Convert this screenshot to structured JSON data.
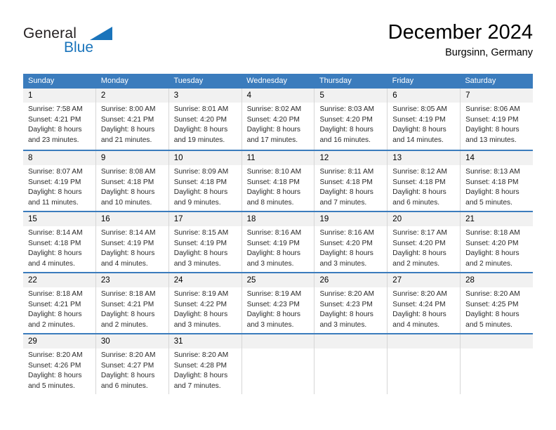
{
  "brand": {
    "name_part1": "General",
    "name_part2": "Blue",
    "accent_color": "#1a74bb"
  },
  "header": {
    "title": "December 2024",
    "subtitle": "Burgsinn, Germany"
  },
  "theme": {
    "header_blue": "#3b7cbd",
    "daynumber_bg": "#f1f1f1",
    "cell_border": "#d6d6d6"
  },
  "weekdays": [
    "Sunday",
    "Monday",
    "Tuesday",
    "Wednesday",
    "Thursday",
    "Friday",
    "Saturday"
  ],
  "weeks": [
    [
      {
        "date": "1",
        "sunrise": "Sunrise: 7:58 AM",
        "sunset": "Sunset: 4:21 PM",
        "daylight_line1": "Daylight: 8 hours",
        "daylight_line2": "and 23 minutes."
      },
      {
        "date": "2",
        "sunrise": "Sunrise: 8:00 AM",
        "sunset": "Sunset: 4:21 PM",
        "daylight_line1": "Daylight: 8 hours",
        "daylight_line2": "and 21 minutes."
      },
      {
        "date": "3",
        "sunrise": "Sunrise: 8:01 AM",
        "sunset": "Sunset: 4:20 PM",
        "daylight_line1": "Daylight: 8 hours",
        "daylight_line2": "and 19 minutes."
      },
      {
        "date": "4",
        "sunrise": "Sunrise: 8:02 AM",
        "sunset": "Sunset: 4:20 PM",
        "daylight_line1": "Daylight: 8 hours",
        "daylight_line2": "and 17 minutes."
      },
      {
        "date": "5",
        "sunrise": "Sunrise: 8:03 AM",
        "sunset": "Sunset: 4:20 PM",
        "daylight_line1": "Daylight: 8 hours",
        "daylight_line2": "and 16 minutes."
      },
      {
        "date": "6",
        "sunrise": "Sunrise: 8:05 AM",
        "sunset": "Sunset: 4:19 PM",
        "daylight_line1": "Daylight: 8 hours",
        "daylight_line2": "and 14 minutes."
      },
      {
        "date": "7",
        "sunrise": "Sunrise: 8:06 AM",
        "sunset": "Sunset: 4:19 PM",
        "daylight_line1": "Daylight: 8 hours",
        "daylight_line2": "and 13 minutes."
      }
    ],
    [
      {
        "date": "8",
        "sunrise": "Sunrise: 8:07 AM",
        "sunset": "Sunset: 4:19 PM",
        "daylight_line1": "Daylight: 8 hours",
        "daylight_line2": "and 11 minutes."
      },
      {
        "date": "9",
        "sunrise": "Sunrise: 8:08 AM",
        "sunset": "Sunset: 4:18 PM",
        "daylight_line1": "Daylight: 8 hours",
        "daylight_line2": "and 10 minutes."
      },
      {
        "date": "10",
        "sunrise": "Sunrise: 8:09 AM",
        "sunset": "Sunset: 4:18 PM",
        "daylight_line1": "Daylight: 8 hours",
        "daylight_line2": "and 9 minutes."
      },
      {
        "date": "11",
        "sunrise": "Sunrise: 8:10 AM",
        "sunset": "Sunset: 4:18 PM",
        "daylight_line1": "Daylight: 8 hours",
        "daylight_line2": "and 8 minutes."
      },
      {
        "date": "12",
        "sunrise": "Sunrise: 8:11 AM",
        "sunset": "Sunset: 4:18 PM",
        "daylight_line1": "Daylight: 8 hours",
        "daylight_line2": "and 7 minutes."
      },
      {
        "date": "13",
        "sunrise": "Sunrise: 8:12 AM",
        "sunset": "Sunset: 4:18 PM",
        "daylight_line1": "Daylight: 8 hours",
        "daylight_line2": "and 6 minutes."
      },
      {
        "date": "14",
        "sunrise": "Sunrise: 8:13 AM",
        "sunset": "Sunset: 4:18 PM",
        "daylight_line1": "Daylight: 8 hours",
        "daylight_line2": "and 5 minutes."
      }
    ],
    [
      {
        "date": "15",
        "sunrise": "Sunrise: 8:14 AM",
        "sunset": "Sunset: 4:18 PM",
        "daylight_line1": "Daylight: 8 hours",
        "daylight_line2": "and 4 minutes."
      },
      {
        "date": "16",
        "sunrise": "Sunrise: 8:14 AM",
        "sunset": "Sunset: 4:19 PM",
        "daylight_line1": "Daylight: 8 hours",
        "daylight_line2": "and 4 minutes."
      },
      {
        "date": "17",
        "sunrise": "Sunrise: 8:15 AM",
        "sunset": "Sunset: 4:19 PM",
        "daylight_line1": "Daylight: 8 hours",
        "daylight_line2": "and 3 minutes."
      },
      {
        "date": "18",
        "sunrise": "Sunrise: 8:16 AM",
        "sunset": "Sunset: 4:19 PM",
        "daylight_line1": "Daylight: 8 hours",
        "daylight_line2": "and 3 minutes."
      },
      {
        "date": "19",
        "sunrise": "Sunrise: 8:16 AM",
        "sunset": "Sunset: 4:20 PM",
        "daylight_line1": "Daylight: 8 hours",
        "daylight_line2": "and 3 minutes."
      },
      {
        "date": "20",
        "sunrise": "Sunrise: 8:17 AM",
        "sunset": "Sunset: 4:20 PM",
        "daylight_line1": "Daylight: 8 hours",
        "daylight_line2": "and 2 minutes."
      },
      {
        "date": "21",
        "sunrise": "Sunrise: 8:18 AM",
        "sunset": "Sunset: 4:20 PM",
        "daylight_line1": "Daylight: 8 hours",
        "daylight_line2": "and 2 minutes."
      }
    ],
    [
      {
        "date": "22",
        "sunrise": "Sunrise: 8:18 AM",
        "sunset": "Sunset: 4:21 PM",
        "daylight_line1": "Daylight: 8 hours",
        "daylight_line2": "and 2 minutes."
      },
      {
        "date": "23",
        "sunrise": "Sunrise: 8:18 AM",
        "sunset": "Sunset: 4:21 PM",
        "daylight_line1": "Daylight: 8 hours",
        "daylight_line2": "and 2 minutes."
      },
      {
        "date": "24",
        "sunrise": "Sunrise: 8:19 AM",
        "sunset": "Sunset: 4:22 PM",
        "daylight_line1": "Daylight: 8 hours",
        "daylight_line2": "and 3 minutes."
      },
      {
        "date": "25",
        "sunrise": "Sunrise: 8:19 AM",
        "sunset": "Sunset: 4:23 PM",
        "daylight_line1": "Daylight: 8 hours",
        "daylight_line2": "and 3 minutes."
      },
      {
        "date": "26",
        "sunrise": "Sunrise: 8:20 AM",
        "sunset": "Sunset: 4:23 PM",
        "daylight_line1": "Daylight: 8 hours",
        "daylight_line2": "and 3 minutes."
      },
      {
        "date": "27",
        "sunrise": "Sunrise: 8:20 AM",
        "sunset": "Sunset: 4:24 PM",
        "daylight_line1": "Daylight: 8 hours",
        "daylight_line2": "and 4 minutes."
      },
      {
        "date": "28",
        "sunrise": "Sunrise: 8:20 AM",
        "sunset": "Sunset: 4:25 PM",
        "daylight_line1": "Daylight: 8 hours",
        "daylight_line2": "and 5 minutes."
      }
    ],
    [
      {
        "date": "29",
        "sunrise": "Sunrise: 8:20 AM",
        "sunset": "Sunset: 4:26 PM",
        "daylight_line1": "Daylight: 8 hours",
        "daylight_line2": "and 5 minutes."
      },
      {
        "date": "30",
        "sunrise": "Sunrise: 8:20 AM",
        "sunset": "Sunset: 4:27 PM",
        "daylight_line1": "Daylight: 8 hours",
        "daylight_line2": "and 6 minutes."
      },
      {
        "date": "31",
        "sunrise": "Sunrise: 8:20 AM",
        "sunset": "Sunset: 4:28 PM",
        "daylight_line1": "Daylight: 8 hours",
        "daylight_line2": "and 7 minutes."
      },
      {
        "date": "",
        "sunrise": "",
        "sunset": "",
        "daylight_line1": "",
        "daylight_line2": ""
      },
      {
        "date": "",
        "sunrise": "",
        "sunset": "",
        "daylight_line1": "",
        "daylight_line2": ""
      },
      {
        "date": "",
        "sunrise": "",
        "sunset": "",
        "daylight_line1": "",
        "daylight_line2": ""
      },
      {
        "date": "",
        "sunrise": "",
        "sunset": "",
        "daylight_line1": "",
        "daylight_line2": ""
      }
    ]
  ]
}
